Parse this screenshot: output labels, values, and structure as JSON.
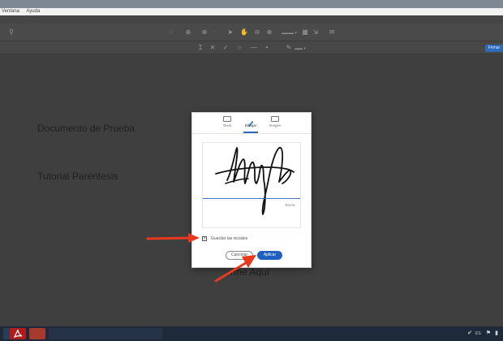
{
  "menubar": {
    "items": [
      "Ventana",
      "Ayuda"
    ]
  },
  "toolbar": {
    "sign_label": "Firmar"
  },
  "document": {
    "lines": [
      "Documento de Prueba",
      "Tutorial Paréntesis",
      "rme Aquí"
    ]
  },
  "dialog": {
    "tabs": [
      {
        "label": "Texto",
        "icon": "text-icon"
      },
      {
        "label": "Dibujar",
        "icon": "pen-icon"
      },
      {
        "label": "Imagen",
        "icon": "image-icon"
      }
    ],
    "clear_label": "Borrar",
    "save_initials_label": "Guardar las iniciales",
    "save_initials_checked": true,
    "cancel_label": "Cancelar",
    "apply_label": "Aplicar"
  },
  "colors": {
    "accent": "#1f5fbf",
    "annotation_arrow": "#e8391e"
  }
}
